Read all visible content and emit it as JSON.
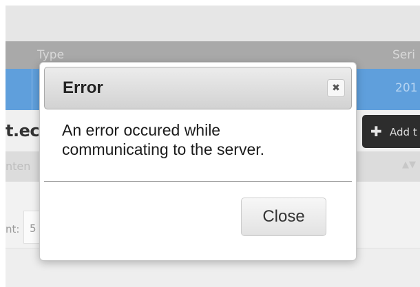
{
  "background": {
    "header_col_type": "Type",
    "header_col_serial": "Seri",
    "row_value": "201",
    "url_fragment": "t.ec",
    "add_button_label": "Add t",
    "sub_header_col": "nten",
    "sub_sort_glyph": "▲▼",
    "count_label": "nt:",
    "count_value": "5"
  },
  "dialog": {
    "title": "Error",
    "close_glyph": "✖",
    "message_line1": "An error occured while",
    "message_line2": "communicating to the server.",
    "close_button_label": "Close"
  }
}
